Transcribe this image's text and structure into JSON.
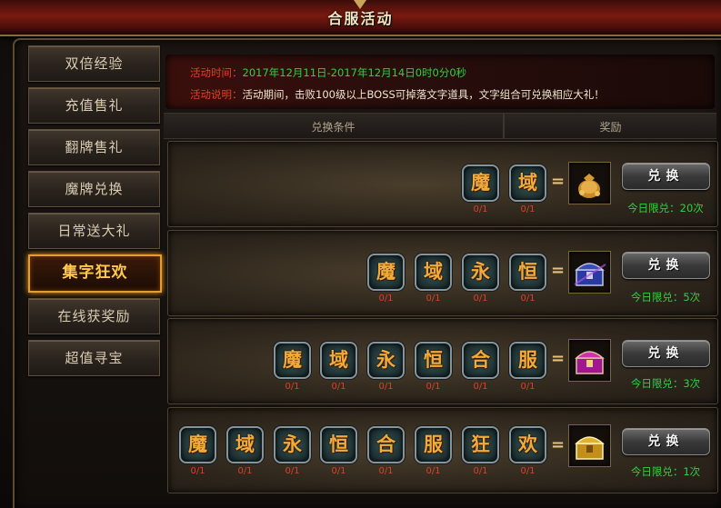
{
  "window": {
    "title": "合服活动"
  },
  "sidebar": {
    "items": [
      {
        "label": "双倍经验"
      },
      {
        "label": "充值售礼"
      },
      {
        "label": "翻牌售礼"
      },
      {
        "label": "魔牌兑换"
      },
      {
        "label": "日常送大礼"
      },
      {
        "label": "集字狂欢",
        "active": true
      },
      {
        "label": "在线获奖励"
      },
      {
        "label": "超值寻宝"
      }
    ]
  },
  "info": {
    "time_label": "活动时间：",
    "time_value": "2017年12月11日-2017年12月14日0时0分0秒",
    "desc_label": "活动说明：",
    "desc_value": "活动期间，击败100级以上BOSS可掉落文字道具，文字组合可兑换相应大礼！"
  },
  "table": {
    "col_condition": "兑换条件",
    "col_reward": "奖励"
  },
  "rows": [
    {
      "chars": [
        "魔",
        "域"
      ],
      "counts": [
        "0/1",
        "0/1"
      ],
      "eq": "=",
      "reward_icon": "gold-pouch-icon",
      "button": "兑换",
      "limit": "今日限兑：20次"
    },
    {
      "chars": [
        "魔",
        "域",
        "永",
        "恒"
      ],
      "counts": [
        "0/1",
        "0/1",
        "0/1",
        "0/1"
      ],
      "eq": "=",
      "reward_icon": "blue-chest-icon",
      "button": "兑换",
      "limit": "今日限兑：5次"
    },
    {
      "chars": [
        "魔",
        "域",
        "永",
        "恒",
        "合",
        "服"
      ],
      "counts": [
        "0/1",
        "0/1",
        "0/1",
        "0/1",
        "0/1",
        "0/1"
      ],
      "eq": "=",
      "reward_icon": "pink-chest-icon",
      "button": "兑换",
      "limit": "今日限兑：3次"
    },
    {
      "chars": [
        "魔",
        "域",
        "永",
        "恒",
        "合",
        "服",
        "狂",
        "欢"
      ],
      "counts": [
        "0/1",
        "0/1",
        "0/1",
        "0/1",
        "0/1",
        "0/1",
        "0/1",
        "0/1"
      ],
      "eq": "=",
      "reward_icon": "gold-chest-icon",
      "button": "兑换",
      "limit": "今日限兑：1次"
    }
  ],
  "colors": {
    "accent": "#ffc94a",
    "time": "#30d040",
    "label": "#e04028",
    "count": "#d8402a",
    "char": "#f2aa3a"
  }
}
